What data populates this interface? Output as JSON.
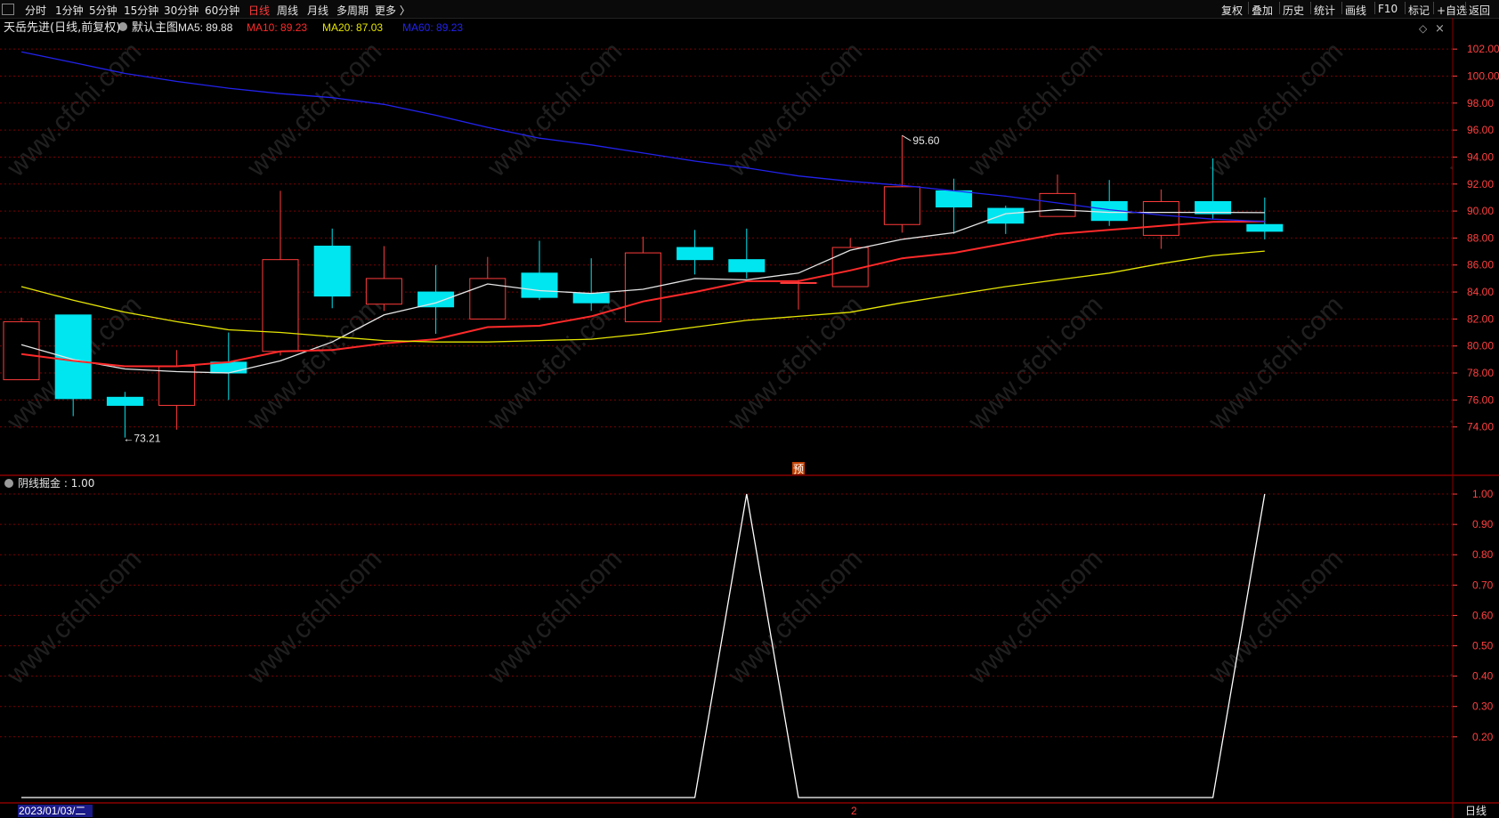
{
  "topbar": {
    "periods": [
      {
        "label": "分时",
        "active": false
      },
      {
        "label": "1分钟",
        "active": false
      },
      {
        "label": "5分钟",
        "active": false
      },
      {
        "label": "15分钟",
        "active": false
      },
      {
        "label": "30分钟",
        "active": false
      },
      {
        "label": "60分钟",
        "active": false
      },
      {
        "label": "日线",
        "active": true
      },
      {
        "label": "周线",
        "active": false
      },
      {
        "label": "月线",
        "active": false
      },
      {
        "label": "多周期",
        "active": false
      },
      {
        "label": "更多 〉",
        "active": false
      }
    ],
    "tools": [
      "复权",
      "叠加",
      "历史",
      "统计",
      "画线",
      "F10",
      "标记",
      "+自选",
      "返回"
    ]
  },
  "main_panel": {
    "stock_name": "天岳先进(日线,前复权)",
    "template_name": "默认主图",
    "ma_labels": [
      {
        "text": "MA5: 89.88",
        "color": "#e6e6e6"
      },
      {
        "text": "MA10: 89.23",
        "color": "#ff2a2a"
      },
      {
        "text": "MA20: 87.03",
        "color": "#e6e600"
      },
      {
        "text": "MA60: 89.23",
        "color": "#2222ee"
      }
    ],
    "high_marker": "95.60",
    "low_marker": "73.21",
    "forecast_badge": "预"
  },
  "indicator_panel": {
    "label": "阴线掘金 : 1.00"
  },
  "bottom_bar": {
    "date": "2023/01/03/二",
    "cursor_mark": "2",
    "period": "日线"
  },
  "colors": {
    "up": "#ff3b3b",
    "down": "#00e6f0",
    "ma5": "#e6e6e6",
    "ma10": "#ff2a2a",
    "ma20": "#e6e600",
    "ma60": "#2222ee",
    "grid": "#7a0000",
    "axis_text": "#ff4040",
    "indicator": "#ffffff"
  },
  "chart_data": [
    {
      "type": "candlestick",
      "title": "天岳先进(日线,前复权)",
      "ylim": [
        72,
        103
      ],
      "y_ticks": [
        "102.00",
        "100.00",
        "98.00",
        "96.00",
        "94.00",
        "92.00",
        "90.00",
        "88.00",
        "86.00",
        "84.00",
        "82.00",
        "80.00",
        "78.00",
        "76.00",
        "74.00"
      ],
      "candles": [
        {
          "o": 77.5,
          "h": 82.1,
          "l": 77.5,
          "c": 81.8
        },
        {
          "o": 82.3,
          "h": 82.3,
          "l": 74.8,
          "c": 76.1
        },
        {
          "o": 76.2,
          "h": 76.6,
          "l": 73.21,
          "c": 75.6
        },
        {
          "o": 75.6,
          "h": 79.7,
          "l": 73.8,
          "c": 78.5
        },
        {
          "o": 78.8,
          "h": 81.0,
          "l": 76.0,
          "c": 78.0
        },
        {
          "o": 79.6,
          "h": 91.5,
          "l": 79.3,
          "c": 86.4
        },
        {
          "o": 87.4,
          "h": 88.7,
          "l": 82.8,
          "c": 83.7
        },
        {
          "o": 83.1,
          "h": 87.4,
          "l": 82.6,
          "c": 85.0
        },
        {
          "o": 84.0,
          "h": 86.0,
          "l": 80.9,
          "c": 82.9
        },
        {
          "o": 82.0,
          "h": 86.6,
          "l": 82.0,
          "c": 85.0
        },
        {
          "o": 85.4,
          "h": 87.8,
          "l": 83.4,
          "c": 83.6
        },
        {
          "o": 83.9,
          "h": 86.5,
          "l": 82.6,
          "c": 83.2
        },
        {
          "o": 81.8,
          "h": 88.1,
          "l": 81.8,
          "c": 86.9
        },
        {
          "o": 87.3,
          "h": 88.6,
          "l": 85.3,
          "c": 86.4
        },
        {
          "o": 86.4,
          "h": 88.7,
          "l": 85.0,
          "c": 85.5
        },
        {
          "o": 84.7,
          "h": 84.9,
          "l": 82.7,
          "c": 84.7
        },
        {
          "o": 84.4,
          "h": 88.0,
          "l": 84.4,
          "c": 87.3
        },
        {
          "o": 89.0,
          "h": 95.6,
          "l": 88.4,
          "c": 91.8
        },
        {
          "o": 91.5,
          "h": 92.4,
          "l": 88.3,
          "c": 90.3
        },
        {
          "o": 90.2,
          "h": 90.4,
          "l": 88.3,
          "c": 89.1
        },
        {
          "o": 89.6,
          "h": 92.7,
          "l": 89.6,
          "c": 91.3
        },
        {
          "o": 90.7,
          "h": 92.3,
          "l": 88.9,
          "c": 89.3
        },
        {
          "o": 88.2,
          "h": 91.6,
          "l": 87.2,
          "c": 90.7
        },
        {
          "o": 90.7,
          "h": 93.9,
          "l": 89.4,
          "c": 89.8
        },
        {
          "o": 89.0,
          "h": 91.0,
          "l": 87.9,
          "c": 88.5
        }
      ],
      "series": [
        {
          "name": "MA5",
          "color": "#e6e6e6",
          "values": [
            80.1,
            79.0,
            78.3,
            78.1,
            78.0,
            78.9,
            80.3,
            82.3,
            83.2,
            84.6,
            84.1,
            83.9,
            84.2,
            85.0,
            84.9,
            85.4,
            87.1,
            87.9,
            88.4,
            89.8,
            90.1,
            89.9,
            89.9,
            89.9,
            89.88
          ]
        },
        {
          "name": "MA10",
          "color": "#ff2a2a",
          "values": [
            79.4,
            78.9,
            78.5,
            78.5,
            78.8,
            79.6,
            79.7,
            80.2,
            80.5,
            81.4,
            81.5,
            82.2,
            83.3,
            84.0,
            84.8,
            84.8,
            85.6,
            86.5,
            86.9,
            87.6,
            88.3,
            88.6,
            88.9,
            89.2,
            89.23
          ]
        },
        {
          "name": "MA20",
          "color": "#e6e600",
          "values": [
            84.4,
            83.4,
            82.5,
            81.8,
            81.2,
            81.0,
            80.7,
            80.4,
            80.3,
            80.3,
            80.4,
            80.5,
            80.9,
            81.4,
            81.9,
            82.2,
            82.5,
            83.2,
            83.8,
            84.4,
            84.9,
            85.4,
            86.1,
            86.7,
            87.03
          ]
        },
        {
          "name": "MA60",
          "color": "#2222ee",
          "values": [
            101.8,
            101.0,
            100.2,
            99.6,
            99.1,
            98.7,
            98.4,
            97.9,
            97.1,
            96.2,
            95.4,
            94.9,
            94.3,
            93.7,
            93.2,
            92.6,
            92.2,
            91.9,
            91.5,
            91.1,
            90.6,
            90.1,
            89.7,
            89.4,
            89.23
          ]
        }
      ]
    },
    {
      "type": "line",
      "title": "阴线掘金",
      "ylim": [
        0,
        1.05
      ],
      "y_ticks": [
        "1.00",
        "0.90",
        "0.80",
        "0.70",
        "0.60",
        "0.50",
        "0.40",
        "0.30",
        "0.20"
      ],
      "series": [
        {
          "name": "阴线掘金",
          "color": "#ffffff",
          "values": [
            0,
            0,
            0,
            0,
            0,
            0,
            0,
            0,
            0,
            0,
            0,
            0,
            0,
            0,
            1,
            0,
            0,
            0,
            0,
            0,
            0,
            0,
            0,
            0,
            1
          ]
        }
      ]
    }
  ]
}
